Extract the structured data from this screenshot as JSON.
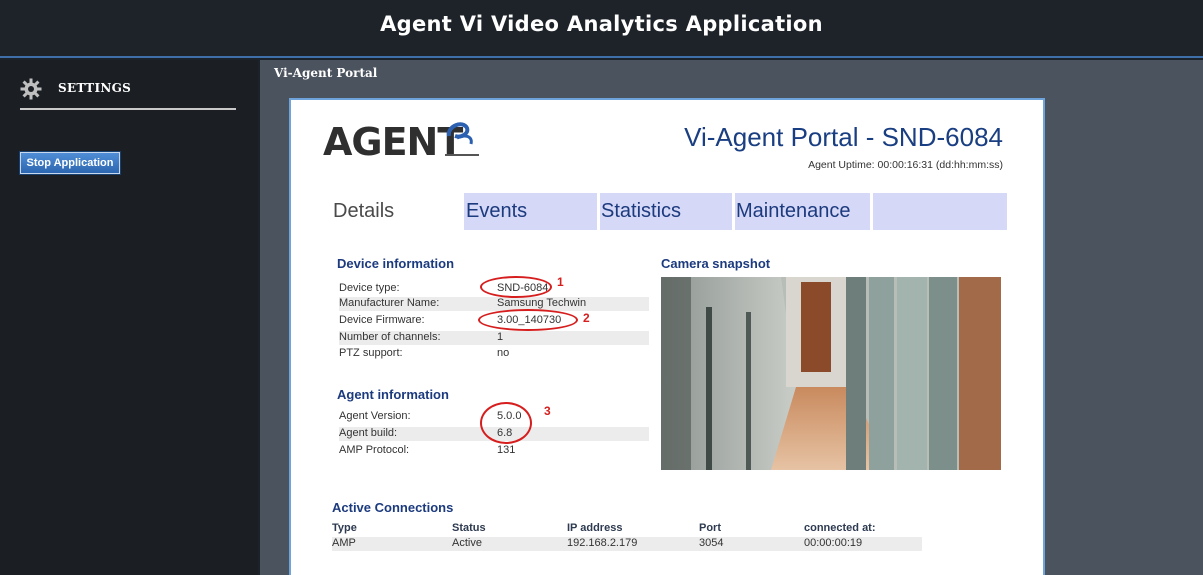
{
  "banner": {
    "title": "Agent Vi Video Analytics Application"
  },
  "sidebar": {
    "settings_label": "SETTINGS",
    "stop_button": "Stop Application"
  },
  "main": {
    "caption": "Vi-Agent Portal"
  },
  "portal": {
    "logo_text": "AGENT",
    "title": "Vi-Agent Portal - SND-6084",
    "uptime": "Agent Uptime: 00:00:16:31 (dd:hh:mm:ss)",
    "tabs": [
      {
        "label": "Details",
        "active": true
      },
      {
        "label": "Events",
        "active": false
      },
      {
        "label": "Statistics",
        "active": false
      },
      {
        "label": "Maintenance",
        "active": false
      }
    ],
    "device_info": {
      "title": "Device information",
      "rows": [
        {
          "label": "Device type:",
          "value": "SND-6084"
        },
        {
          "label": "Manufacturer Name:",
          "value": "Samsung Techwin"
        },
        {
          "label": "Device Firmware:",
          "value": "3.00_140730"
        },
        {
          "label": "Number of channels:",
          "value": "1"
        },
        {
          "label": "PTZ support:",
          "value": "no"
        }
      ]
    },
    "agent_info": {
      "title": "Agent information",
      "rows": [
        {
          "label": "Agent Version:",
          "value": "5.0.0"
        },
        {
          "label": "Agent build:",
          "value": "6.8"
        },
        {
          "label": "AMP Protocol:",
          "value": "131"
        }
      ]
    },
    "snapshot": {
      "title": "Camera snapshot"
    },
    "annotations": [
      "1",
      "2",
      "3"
    ],
    "connections": {
      "title": "Active Connections",
      "headers": [
        "Type",
        "Status",
        "IP address",
        "Port",
        "connected at:"
      ],
      "rows": [
        [
          "AMP",
          "Active",
          "192.168.2.179",
          "3054",
          "00:00:00:19"
        ]
      ]
    }
  },
  "colors": {
    "banner_bg": "#1e2329",
    "accent_blue": "#1c3a7e",
    "tab_bg": "#d5d8f6",
    "annotation_red": "#d61e1e",
    "main_bg": "#4b535e"
  }
}
